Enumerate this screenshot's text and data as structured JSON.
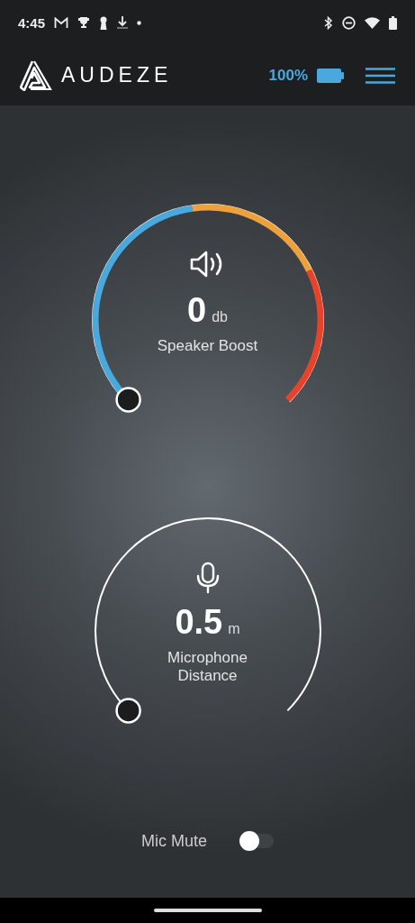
{
  "status_bar": {
    "time": "4:45"
  },
  "header": {
    "brand": "AUDEZE",
    "battery_percent": "100%"
  },
  "dials": [
    {
      "kind": "segmented",
      "value": "0",
      "unit": "db",
      "label": "Speaker Boost"
    },
    {
      "kind": "plain",
      "value": "0.5",
      "unit": "m",
      "label": "Microphone Distance"
    }
  ],
  "mic_mute": {
    "label": "Mic Mute",
    "on": false
  }
}
